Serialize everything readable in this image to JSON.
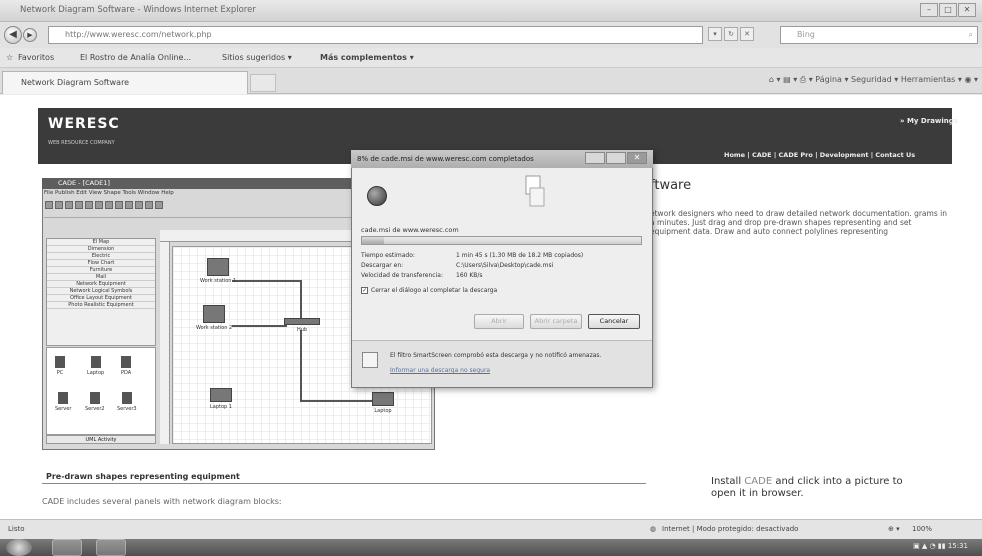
{
  "browser": {
    "window_title": "Network Diagram Software - Windows Internet Explorer",
    "url": "http://www.weresc.com/network.php",
    "search_placeholder": "Bing",
    "favorites": {
      "label": "Favoritos",
      "items": [
        "El Rostro de Analía Online...",
        "Sitios sugeridos ▾",
        "Más complementos ▾"
      ]
    },
    "tab_label": "Network Diagram Software",
    "commands": "Página ▾  Seguridad ▾  Herramientas ▾"
  },
  "page": {
    "logo": "WERESC",
    "slogan": "WEB RESOURCE COMPANY",
    "my_drawings": "» My Drawings",
    "nav": "Home | CADE | CADE Pro | Development | Contact Us",
    "heading": "ftware",
    "description": "etwork designers who need to draw detailed network documentation. grams in a minutes. Just drag and drop pre-drawn shapes representing and set equipment data. Draw and auto connect polylines representing",
    "section_heading": "Pre-drawn shapes representing equipment",
    "section_text": "CADE includes several panels with network diagram blocks:",
    "install_text": "Install",
    "install_highlight": "CADE",
    "install_rest": "and click into a picture to open it in browser."
  },
  "cade_app": {
    "title": "CADE - [CADE1]",
    "menu": "File  Publish  Edit  View  Shape  Tools  Window  Help",
    "panels": [
      "El Map",
      "Dimension",
      "Electric",
      "Flow Chart",
      "Furniture",
      "Mail",
      "Network Equipment",
      "Network Logical Symbols",
      "Office Layout Equipment",
      "Photo Realistic Equipment"
    ],
    "shapes": [
      "PC",
      "Laptop",
      "PDA",
      "Server",
      "Server2",
      "Server3"
    ],
    "uml_label": "UML Activity",
    "devices": [
      "Work station 1",
      "Work station 2",
      "Hub",
      "Laptop 1",
      "Laptop"
    ]
  },
  "download_dialog": {
    "title": "8% de cade.msi de www.weresc.com completados",
    "file": "cade.msi de www.weresc.com",
    "progress_percent": 8,
    "rows": [
      {
        "label": "Tiempo estimado:",
        "value": "1 min 45 s (1.30 MB de 18.2 MB copiados)"
      },
      {
        "label": "Descargar en:",
        "value": "C:\\Users\\Silva\\Desktop\\cade.msi"
      },
      {
        "label": "Velocidad de transferencia:",
        "value": "160 KB/s"
      }
    ],
    "checkbox_label": "Cerrar el diálogo al completar la descarga",
    "checkbox_checked": true,
    "buttons": {
      "open": "Abrir",
      "open_folder": "Abrir carpeta",
      "cancel": "Cancelar"
    },
    "smartscreen_text": "El filtro SmartScreen comprobó esta descarga y no notificó amenazas.",
    "smartscreen_link": "Informar una descarga no segura"
  },
  "status": {
    "left": "Listo",
    "zone": "Internet | Modo protegido: desactivado",
    "zoom": "100%"
  },
  "taskbar": {
    "clock": "15:31"
  }
}
